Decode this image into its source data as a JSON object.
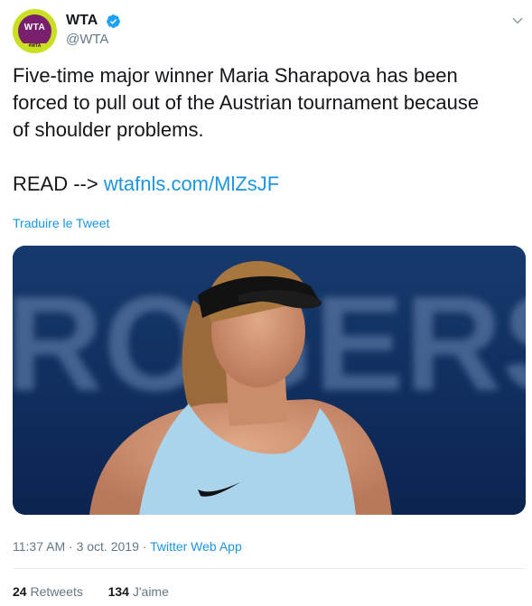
{
  "author": {
    "avatar_text": "WTA",
    "avatar_tag": "#WTA",
    "display_name": "WTA",
    "handle": "@WTA"
  },
  "tweet": {
    "text_line_1": "Five-time major winner Maria Sharapova has been",
    "text_line_2": "forced to pull out of the Austrian tournament because",
    "text_line_3": "of shoulder problems.",
    "read_prefix": "READ --> ",
    "link_text": "wtafnls.com/MlZsJF",
    "translate_label": "Traduire le Tweet"
  },
  "media": {
    "background_text": "ROGERS"
  },
  "meta": {
    "time": "11:37 AM",
    "date": "3 oct. 2019",
    "separator": "·",
    "source": "Twitter Web App"
  },
  "stats": {
    "retweets_count": "24",
    "retweets_label": "Retweets",
    "likes_count": "134",
    "likes_label": "J'aime"
  },
  "colors": {
    "link": "#1b95e0",
    "secondary_text": "#657786",
    "primary_text": "#14171a",
    "avatar_bg": "#c8e01f",
    "avatar_inner": "#7a1f6e"
  },
  "icons": [
    "verified-icon",
    "chevron-down-icon",
    "wta-logo"
  ]
}
